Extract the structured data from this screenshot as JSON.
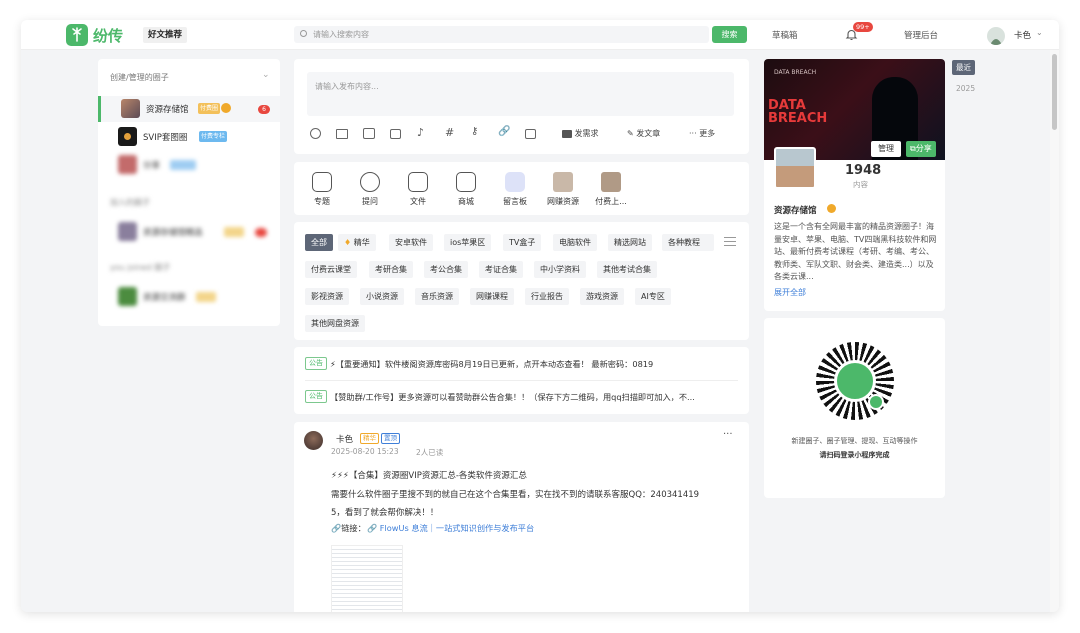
{
  "header": {
    "logo_name": "纷传",
    "featured_tab": "好文推荐",
    "search_placeholder": "请输入搜索内容",
    "search_button": "搜索",
    "drafts": "草稿箱",
    "notification_badge": "99+",
    "admin": "管理后台",
    "username": "卡色"
  },
  "sidebar": {
    "section1_title": "创建/管理的圈子",
    "items": [
      {
        "label": "资源存储馆",
        "badge": "付费圈",
        "count": "6"
      },
      {
        "label": "SVIP套图圈",
        "badge": "付费专栏"
      },
      {
        "label": "分享"
      }
    ],
    "section2_title": "加入的圈子",
    "section2_items": [
      {
        "label": "资源存储馆精选"
      }
    ],
    "section3_title": "you joined 圈子",
    "section3_items": [
      {
        "label": "资源交流群"
      }
    ]
  },
  "composer": {
    "placeholder": "请输入发布内容...",
    "req_label": "发需求",
    "article_label": "发文章",
    "more_label": "更多"
  },
  "services": [
    {
      "label": "专题",
      "icon": "topic-icon"
    },
    {
      "label": "提问",
      "icon": "question-icon"
    },
    {
      "label": "文件",
      "icon": "file-icon"
    },
    {
      "label": "商城",
      "icon": "shop-icon"
    },
    {
      "label": "留言板",
      "icon": "message-board-icon"
    },
    {
      "label": "网赚资源",
      "icon": "avatar-icon"
    },
    {
      "label": "付费上...",
      "icon": "avatar-icon"
    }
  ],
  "categories": {
    "row1": [
      "全部",
      "精华",
      "安卓软件",
      "ios苹果区",
      "TV盒子",
      "电脑软件",
      "精选网站",
      "各种教程"
    ],
    "row2": [
      "付费云课堂",
      "考研合集",
      "考公合集",
      "考证合集",
      "中小学资料",
      "其他考试合集"
    ],
    "row3": [
      "影视资源",
      "小说资源",
      "音乐资源",
      "网赚课程",
      "行业报告",
      "游戏资源",
      "AI专区"
    ],
    "row4": [
      "其他网盘资源"
    ]
  },
  "notices": [
    {
      "tag": "公告",
      "text": "⚡【重要通知】软件楼阁资源库密码8月19日已更新，点开本动态查看！ 最新密码：0819"
    },
    {
      "tag": "公告",
      "text": "【赞助群/工作号】更多资源可以看赞助群公告合集！！（保存下方二维码，用qq扫描即可加入，不..."
    }
  ],
  "post": {
    "author": "卡色",
    "badge_featured": "精华",
    "badge_top": "置顶",
    "date": "2025-08-20 15:23",
    "reads": "2人已读",
    "more": "···",
    "title": "⚡⚡⚡【合集】资源圈VIP资源汇总-各类软件资源汇总",
    "body1": "需要什么软件圈子里搜不到的就自己在这个合集里看，实在找不到的请联系客服QQ：240341419",
    "body2": "5，看到了就会帮你解决！！",
    "link_prefix": "🔗链接：",
    "link_text": "🔗 FlowUs 息流｜一站式知识创作与发布平台"
  },
  "profile": {
    "banner_text1": "DATA BREACH",
    "banner_text2": "DATA BREACH",
    "manage_btn": "管理",
    "share_btn": "分享",
    "count": "1948",
    "count_label": "内容",
    "name": "资源存储馆",
    "desc": "这是一个含有全网最丰富的精品资源圈子！海量安卓、苹果、电脑、TV四端黑科技软件和网站、最新付费考试课程（考研、考编、考公、教师类、军队文职、财会类、建造类...）以及各类云课...",
    "expand": "展开全部"
  },
  "qr": {
    "line1": "新建圈子、圈子管理、提现、互动等操作",
    "line2": "请扫码登录小程序完成"
  },
  "timeline": {
    "recent": "最近",
    "year": "2025"
  },
  "colors": {
    "brand": "#4cb86a",
    "badge_red": "#e8473f",
    "gold": "#f0a92b",
    "link": "#3f7fd8"
  }
}
